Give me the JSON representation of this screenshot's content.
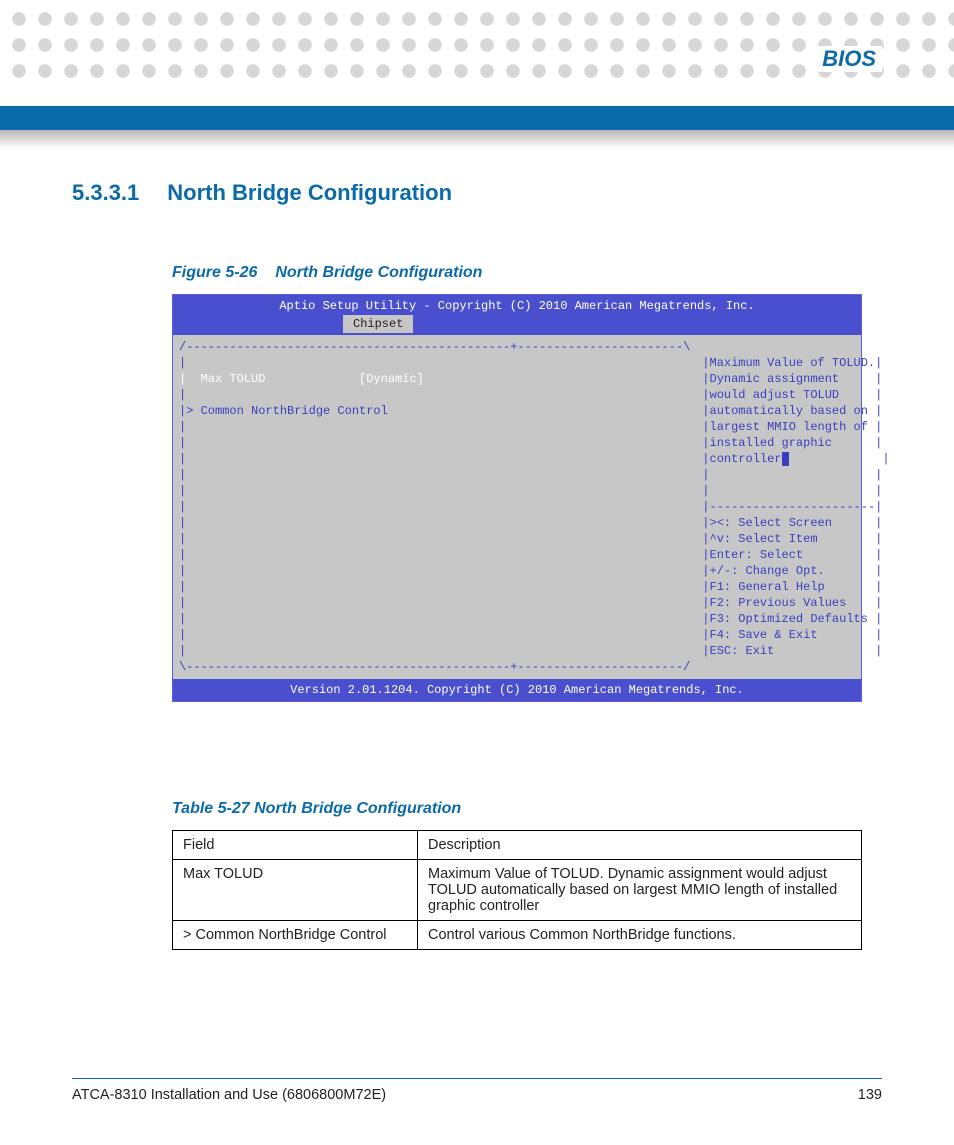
{
  "chapter": "BIOS",
  "section": {
    "number": "5.3.3.1",
    "title": "North Bridge Configuration"
  },
  "figure": {
    "label": "Figure 5-26",
    "title": "North Bridge Configuration"
  },
  "bios": {
    "header": "Aptio Setup Utility - Copyright (C) 2010 American Megatrends, Inc.",
    "tab": "Chipset",
    "left_border_top": "/---------------------------------------------+-----------------------\\",
    "left_blank": "|                                             ",
    "left_item1": "|  Max TOLUD             [Dynamic]            ",
    "left_item2": "|> Common NorthBridge Control                 ",
    "left_border_bot": "\\---------------------------------------------+-----------------------/",
    "help": [
      "|Maximum Value of TOLUD.|",
      "|Dynamic assignment     |",
      "|would adjust TOLUD     |",
      "|automatically based on |",
      "|largest MMIO length of |",
      "|installed graphic      |",
      "|controller",
      "|                       |",
      "|                       |",
      "|-----------------------|",
      "|><: Select Screen      |",
      "|^v: Select Item        |",
      "|Enter: Select          |",
      "|+/-: Change Opt.       |",
      "|F1: General Help       |",
      "|F2: Previous Values    |",
      "|F3: Optimized Defaults |",
      "|F4: Save & Exit        |",
      "|ESC: Exit              |"
    ],
    "help_cursor_tail": "             |",
    "footer": "Version 2.01.1204. Copyright (C) 2010 American Megatrends, Inc."
  },
  "table": {
    "label": "Table 5-27 North Bridge Configuration",
    "head": {
      "c1": "Field",
      "c2": "Description"
    },
    "rows": [
      {
        "c1": "Max TOLUD",
        "c2": "Maximum Value of TOLUD. Dynamic assignment would adjust TOLUD automatically based on largest MMIO length of installed graphic controller"
      },
      {
        "c1": "> Common NorthBridge Control",
        "c2": "Control various Common NorthBridge functions."
      }
    ]
  },
  "footer": {
    "left": "ATCA-8310 Installation and Use (6806800M72E)",
    "right": "139"
  }
}
